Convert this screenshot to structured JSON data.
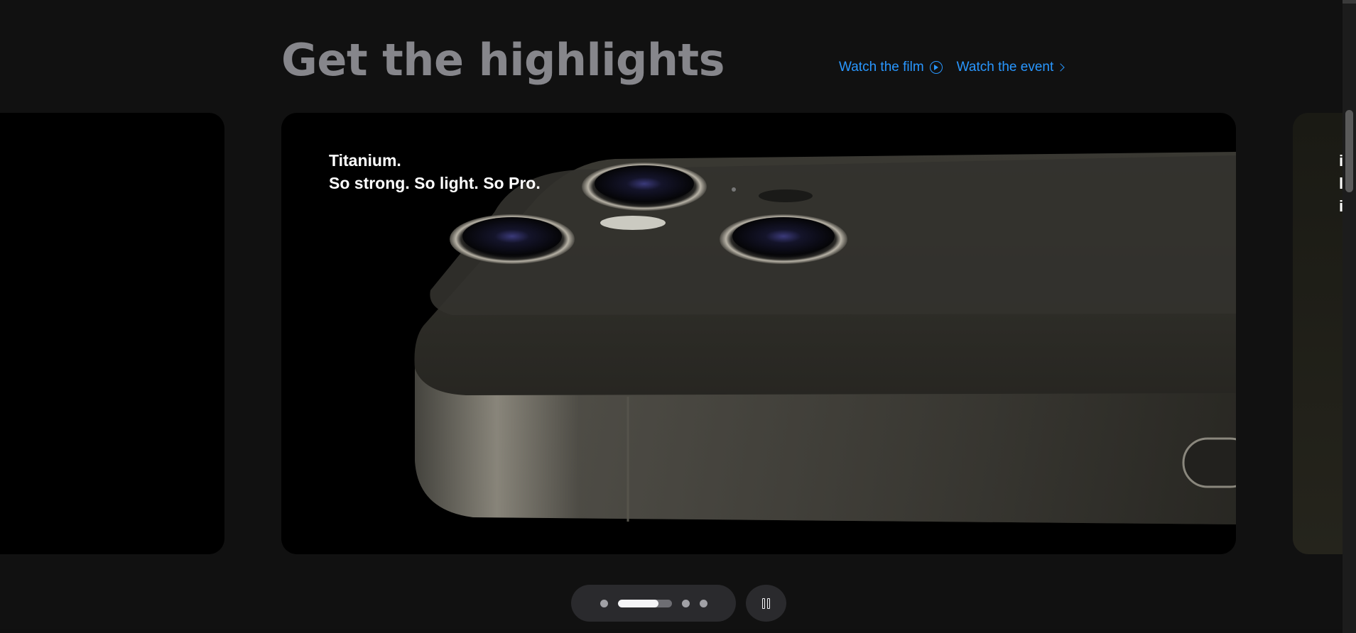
{
  "section": {
    "title": "Get the highlights",
    "links": {
      "film_label": "Watch the film",
      "event_label": "Watch the event"
    }
  },
  "slides": {
    "active": {
      "caption_line1": "Titanium.",
      "caption_line2": "So strong. So light. So Pro."
    },
    "next_peek": {
      "line1": "i",
      "line2": "l",
      "line3": "i"
    }
  },
  "pager": {
    "dot_count": 4,
    "active_index": 1,
    "active_progress": 0.75
  },
  "colors": {
    "link": "#2997ff",
    "heading": "#86868b",
    "background": "#111111"
  },
  "icons": {
    "film": "play-circle-icon",
    "event": "chevron-right-icon",
    "pause": "pause-icon"
  }
}
